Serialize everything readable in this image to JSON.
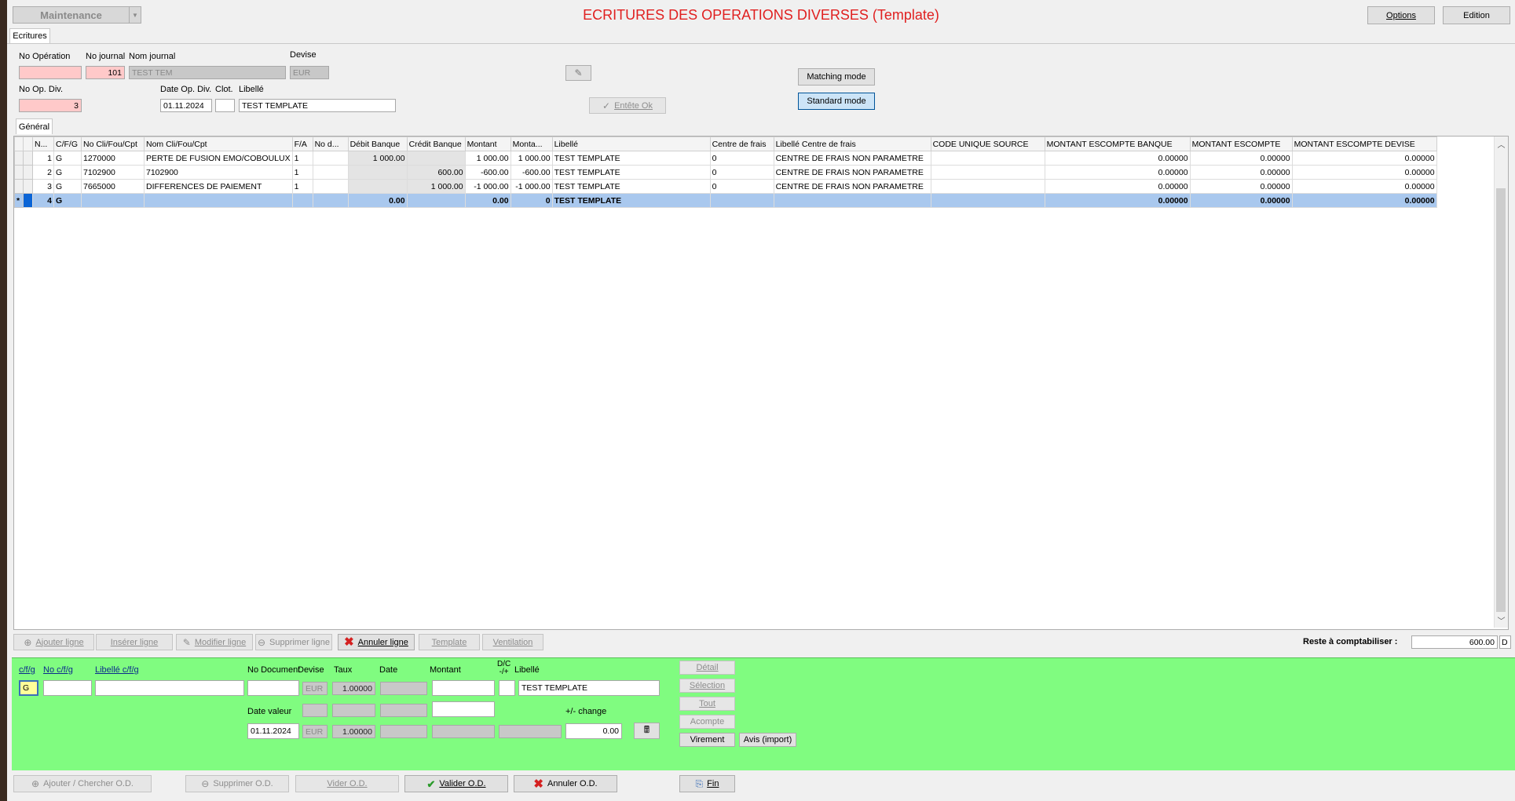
{
  "header": {
    "module_dropdown": "Maintenance",
    "title": "ECRITURES DES OPERATIONS DIVERSES (Template)",
    "options_button": "Options",
    "edition_button": "Edition"
  },
  "tabs": {
    "ecritures": "Ecritures",
    "general": "Général"
  },
  "form": {
    "no_operation_label": "No Opération",
    "no_operation_value": "",
    "no_journal_label": "No journal",
    "no_journal_value": "101",
    "nom_journal_label": "Nom journal",
    "nom_journal_value": "TEST TEM",
    "devise_label": "Devise",
    "devise_value": "EUR",
    "no_op_div_label": "No Op. Div.",
    "no_op_div_value": "3",
    "date_op_div_label": "Date Op. Div.",
    "date_op_div_value": "01.11.2024",
    "clot_label": "Clot.",
    "clot_value": "",
    "libelle_label": "Libellé",
    "libelle_value": "TEST TEMPLATE",
    "entete_ok_button": "Entête Ok",
    "matching_mode_button": "Matching mode",
    "standard_mode_button": "Standard mode"
  },
  "grid": {
    "columns": [
      "N...",
      "C/F/G",
      "No Cli/Fou/Cpt",
      "Nom Cli/Fou/Cpt",
      "F/A",
      "No d...",
      "Débit Banque",
      "Crédit Banque",
      "Montant",
      "Monta...",
      "Libellé",
      "Centre de frais",
      "Libellé Centre de frais",
      "CODE UNIQUE SOURCE",
      "MONTANT ESCOMPTE BANQUE",
      "MONTANT ESCOMPTE",
      "MONTANT ESCOMPTE DEVISE"
    ],
    "rows": [
      {
        "marker": "",
        "n": "1",
        "cfg": "G",
        "no": "1270000",
        "nom": "PERTE DE FUSION EMO/COBOULUX",
        "fa": "1",
        "nod": "",
        "debit": "1 000.00",
        "credit": "",
        "montant": "1 000.00",
        "monta": "1 000.00",
        "libelle": "TEST TEMPLATE",
        "centre": "0",
        "lib_centre": "CENTRE DE FRAIS NON PARAMETRE",
        "code": "",
        "mesc_banque": "0.00000",
        "mesc": "0.00000",
        "mesc_devise": "0.00000"
      },
      {
        "marker": "",
        "n": "2",
        "cfg": "G",
        "no": "7102900",
        "nom": "7102900",
        "fa": "1",
        "nod": "",
        "debit": "",
        "credit": "600.00",
        "montant": "-600.00",
        "monta": "-600.00",
        "libelle": "TEST TEMPLATE",
        "centre": "0",
        "lib_centre": "CENTRE DE FRAIS NON PARAMETRE",
        "code": "",
        "mesc_banque": "0.00000",
        "mesc": "0.00000",
        "mesc_devise": "0.00000"
      },
      {
        "marker": "",
        "n": "3",
        "cfg": "G",
        "no": "7665000",
        "nom": "DIFFERENCES DE PAIEMENT",
        "fa": "1",
        "nod": "",
        "debit": "",
        "credit": "1 000.00",
        "montant": "-1 000.00",
        "monta": "-1 000.00",
        "libelle": "TEST TEMPLATE",
        "centre": "0",
        "lib_centre": "CENTRE DE FRAIS NON PARAMETRE",
        "code": "",
        "mesc_banque": "0.00000",
        "mesc": "0.00000",
        "mesc_devise": "0.00000"
      },
      {
        "marker": "*",
        "n": "4",
        "cfg": "G",
        "no": "",
        "nom": "",
        "fa": "",
        "nod": "",
        "debit": "0.00",
        "credit": "",
        "montant": "0.00",
        "monta": "0",
        "libelle": "TEST TEMPLATE",
        "centre": "",
        "lib_centre": "",
        "code": "",
        "mesc_banque": "0.00000",
        "mesc": "0.00000",
        "mesc_devise": "0.00000"
      }
    ]
  },
  "line_buttons": {
    "ajouter": "Ajouter ligne",
    "inserer": "Insérer ligne",
    "modifier": "Modifier ligne",
    "supprimer": "Supprimer ligne",
    "annuler": "Annuler ligne",
    "template": "Template",
    "ventilation": "Ventilation"
  },
  "reste": {
    "label": "Reste à comptabiliser :",
    "value": "600.00",
    "dc": "D"
  },
  "entry": {
    "cfg_label": "c/f/g",
    "no_cfg_label": "No c/f/g",
    "libelle_cfg_label": "Libellé c/f/g",
    "no_document_label": "No Document",
    "devise_label": "Devise",
    "taux_label": "Taux",
    "date_label": "Date",
    "montant_label": "Montant",
    "dc_label": "D/C\n-/+",
    "libelle_label": "Libellé",
    "cfg_value": "G",
    "no_cfg_value": "",
    "libelle_cfg_value": "",
    "no_document_value": "",
    "devise_value": "EUR",
    "taux_value": "1.00000",
    "date_value": "",
    "montant_value": "",
    "dc_value": "",
    "libelle_value": "TEST TEMPLATE",
    "montant2_value": "",
    "date_valeur_label": "Date valeur",
    "date_valeur_value": "01.11.2024",
    "devise2_value": "EUR",
    "taux2_value": "1.00000",
    "change_label": "+/- change",
    "change_value": "0.00"
  },
  "side_buttons": {
    "detail": "Détail",
    "selection": "Sélection",
    "tout": "Tout",
    "acompte": "Acompte",
    "virement": "Virement",
    "avis": "Avis (import)"
  },
  "footer": {
    "ajouter_od": "Ajouter / Chercher O.D.",
    "supprimer_od": "Supprimer O.D.",
    "vider_od": "Vider O.D.",
    "valider_od": "Valider O.D.",
    "annuler_od": "Annuler O.D.",
    "fin": "Fin"
  },
  "colors": {
    "title_red": "#e02020",
    "pink_field": "#ffc9c9",
    "green_panel": "#80fc80",
    "new_row_blue": "#a9c8ee"
  }
}
